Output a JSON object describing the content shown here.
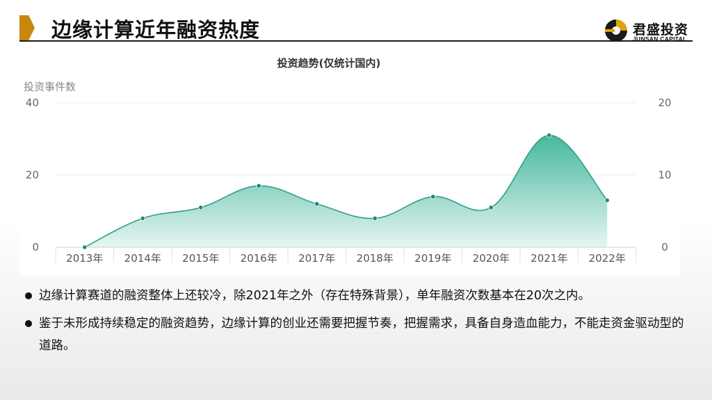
{
  "page": {
    "title": "边缘计算近年融资热度"
  },
  "logo": {
    "name_cn": "君盛投资",
    "name_en": "JUNSAN CAPITAL",
    "colors": {
      "gold": "#e0a10b",
      "dark": "#1a1a1a"
    }
  },
  "chart_data": {
    "type": "area",
    "title": "投资趋势(仅统计国内)",
    "ylabel": "投资事件数",
    "categories": [
      "2013年",
      "2014年",
      "2015年",
      "2016年",
      "2017年",
      "2018年",
      "2019年",
      "2020年",
      "2021年",
      "2022年"
    ],
    "series": [
      {
        "values": [
          0,
          8,
          11,
          17,
          12,
          8,
          14,
          11,
          31,
          13
        ]
      }
    ],
    "ylim": [
      0,
      40
    ],
    "yticks": [
      "0",
      "20",
      "40"
    ],
    "y2lim": [
      0,
      20
    ],
    "y2ticks": [
      "0",
      "10",
      "20"
    ],
    "grid": true,
    "colors": {
      "line": "#2f9e88",
      "fill_top": "#46b89e",
      "fill_bottom": "#e6f5f1",
      "point": "#1f8a70"
    }
  },
  "bullets": [
    "边缘计算赛道的融资整体上还较冷，除2021年之外（存在特殊背景），单年融资次数基本在20次之内。",
    "鉴于未形成持续稳定的融资趋势，边缘计算的创业还需要把握节奏，把握需求，具备自身造血能力，不能走资金驱动型的道路。"
  ]
}
